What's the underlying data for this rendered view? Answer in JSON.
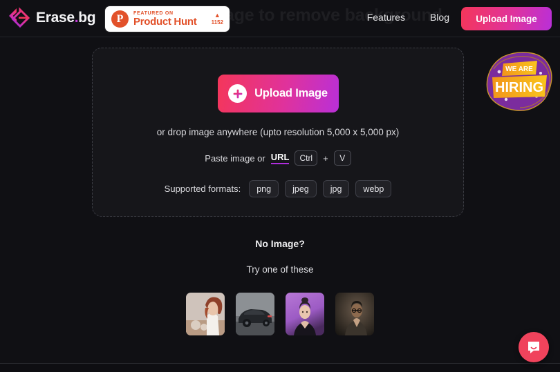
{
  "hero": {
    "ghost_headline": "Upload an image to remove background"
  },
  "header": {
    "logo": {
      "mark_icon": "erasebg-diamond-logo-icon",
      "name_main": "Erase",
      "name_dot": ".",
      "name_suffix": "bg"
    },
    "product_hunt_badge": {
      "logo_icon": "product-hunt-p-icon",
      "featured_text": "FEATURED ON",
      "name": "Product Hunt",
      "upvote_arrow": "▲",
      "upvote_count": "1152"
    },
    "nav": [
      {
        "label": "Features"
      },
      {
        "label": "Blog"
      }
    ],
    "cta_label": "Upload Image"
  },
  "dropzone": {
    "upload_button": {
      "icon": "plus-circle-icon",
      "label": "Upload Image"
    },
    "drop_hint": "or drop image anywhere (upto resolution 5,000 x 5,000 px)",
    "paste_prefix": "Paste image or",
    "paste_url_link": "URL",
    "key_ctrl": "Ctrl",
    "key_plus": "+",
    "key_v": "V",
    "formats_label": "Supported formats:",
    "formats": [
      {
        "label": "png"
      },
      {
        "label": "jpeg"
      },
      {
        "label": "jpg"
      },
      {
        "label": "webp"
      }
    ]
  },
  "hiring_badge": {
    "icon": "we-are-hiring-badge-icon",
    "line1": "WE ARE",
    "line2": "HIRING"
  },
  "samples": {
    "heading": "No Image?",
    "subheading": "Try one of these",
    "thumbnails": [
      {
        "name": "sample-woman-white-blazer"
      },
      {
        "name": "sample-black-sports-car"
      },
      {
        "name": "sample-woman-purple-backdrop"
      },
      {
        "name": "sample-man-dark-portrait"
      }
    ]
  },
  "chat": {
    "icon": "chat-bubble-smile-icon"
  },
  "colors": {
    "page_bg": "#101014",
    "dropzone_bg": "#16161a",
    "dashed_border": "#3b3c43",
    "gradient_start": "#f4365a",
    "gradient_mid": "#e0329b",
    "gradient_end": "#b930d8",
    "product_hunt_orange": "#e2512a",
    "url_underline": "#b02ddd",
    "chat_red": "#f0435c",
    "hiring_purple": "#7b2c9e",
    "hiring_orange": "#f5a21b"
  }
}
